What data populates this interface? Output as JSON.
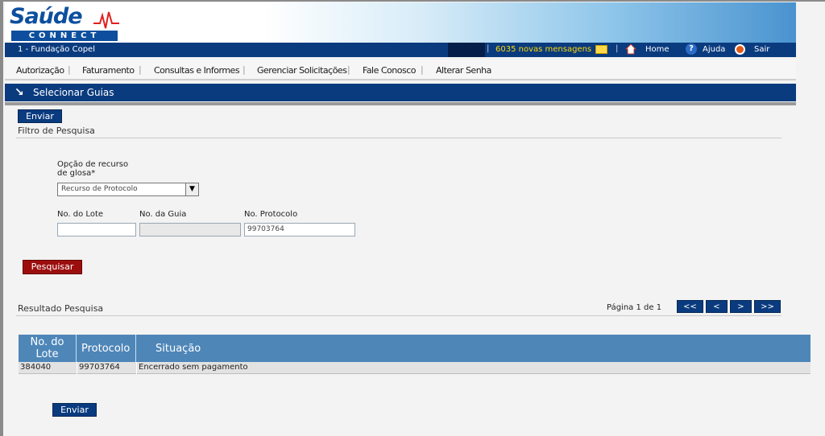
{
  "header": {
    "logo_main": "Saúde",
    "logo_sub": "CONNECT",
    "organization": "1 - Fundação Copel",
    "messages": "6035 novas mensagens",
    "home_label": "Home",
    "help_label": "Ajuda",
    "exit_label": "Sair"
  },
  "nav": {
    "items": [
      {
        "label": "Autorização"
      },
      {
        "label": "Faturamento"
      },
      {
        "label": "Consultas e Informes"
      },
      {
        "label": "Gerenciar Solicitações"
      },
      {
        "label": "Fale Conosco"
      },
      {
        "label": "Alterar Senha"
      }
    ]
  },
  "section": {
    "title": "Selecionar Guias"
  },
  "actions": {
    "send_top": "Enviar",
    "send_bottom": "Enviar",
    "search": "Pesquisar"
  },
  "filter": {
    "title": "Filtro de Pesquisa",
    "recurso_label_line1": "Opção de recurso",
    "recurso_label_line2": "de glosa*",
    "recurso_value": "Recurso de Protocolo",
    "lote_label": "No. do Lote",
    "lote_value": "",
    "guia_label": "No. da Guia",
    "guia_value": "",
    "protocolo_label": "No. Protocolo",
    "protocolo_value": "99703764"
  },
  "results": {
    "title": "Resultado Pesquisa",
    "page_info": "Página 1 de 1",
    "pager": {
      "first": "<<",
      "prev": "<",
      "next": ">",
      "last": ">>"
    },
    "columns": {
      "lote_line1": "No. do",
      "lote_line2": "Lote",
      "protocolo": "Protocolo",
      "situacao": "Situação"
    },
    "rows": [
      {
        "lote": "384040",
        "protocolo": "99703764",
        "situacao": "Encerrado sem pagamento"
      }
    ]
  },
  "colors": {
    "primary_blue": "#0a3b7f",
    "table_header": "#4e86b8",
    "search_button": "#9c0e0e",
    "messages_text": "#ffd700"
  }
}
